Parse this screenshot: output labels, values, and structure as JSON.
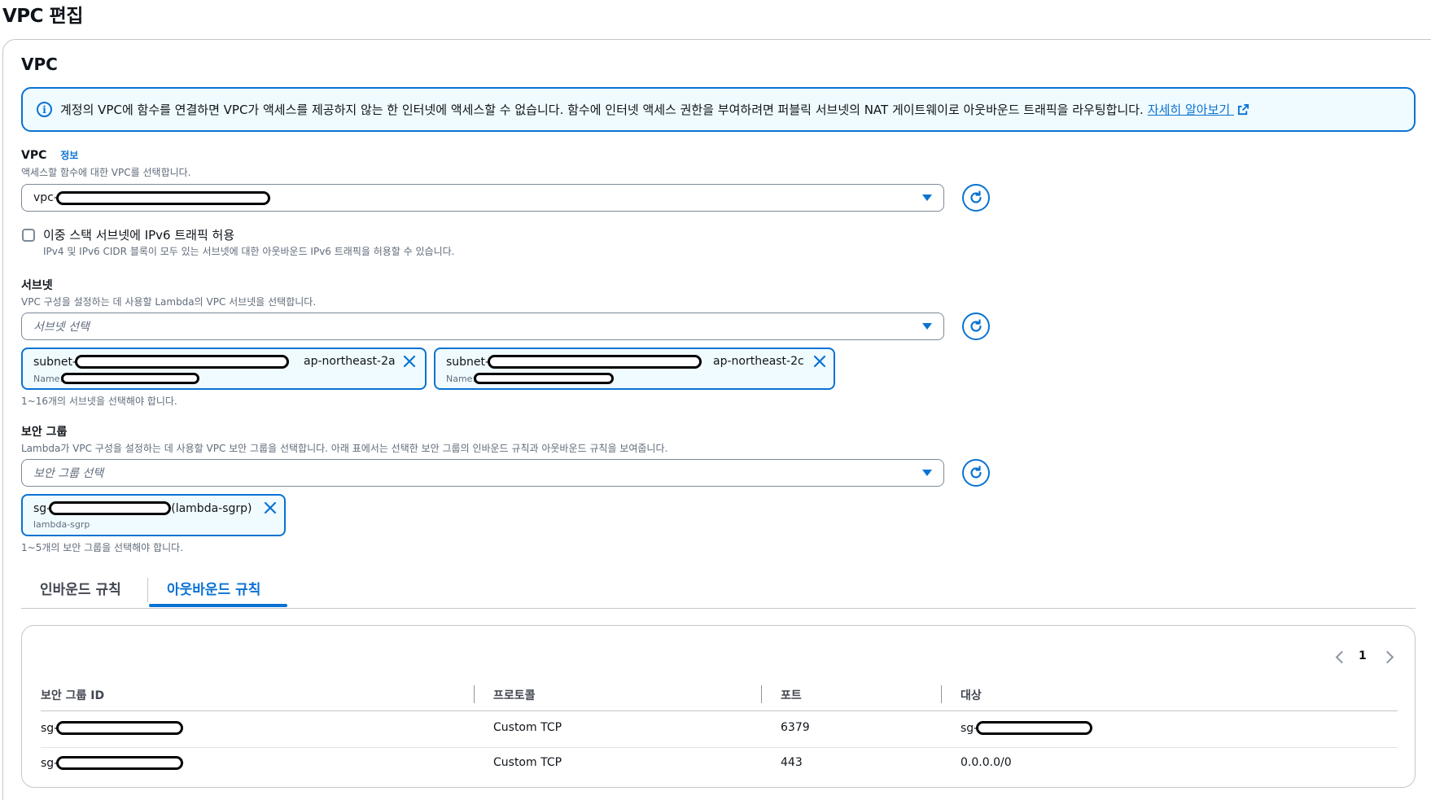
{
  "page": {
    "title": "VPC 편집"
  },
  "section": {
    "title": "VPC"
  },
  "alert": {
    "text": "계정의 VPC에 함수를 연결하면 VPC가 액세스를 제공하지 않는 한 인터넷에 액세스할 수 없습니다. 함수에 인터넷 액세스 권한을 부여하려면 퍼블릭 서브넷의 NAT 게이트웨이로 아웃바운드 트래픽을 라우팅합니다.",
    "link": "자세히 알아보기",
    "icon": "info-icon",
    "accent": "#0972d3"
  },
  "vpc": {
    "label": "VPC",
    "info": "정보",
    "description": "액세스할 함수에 대한 VPC를 선택합니다.",
    "value_prefix": "vpc-"
  },
  "dualstack": {
    "label": "이중 스택 서브넷에 IPv6 트래픽 허용",
    "description": "IPv4 및 IPv6 CIDR 블록이 모두 있는 서브넷에 대한 아웃바운드 IPv6 트래픽을 허용할 수 있습니다."
  },
  "subnets": {
    "label": "서브넷",
    "description": "VPC 구성을 설정하는 데 사용할 Lambda의 VPC 서브넷을 선택합니다.",
    "placeholder": "서브넷 선택",
    "tokens": [
      {
        "prefix": "subnet-",
        "az": "ap-northeast-2a",
        "name_label": "Name:"
      },
      {
        "prefix": "subnet-",
        "az": "ap-northeast-2c",
        "name_label": "Name:"
      }
    ],
    "hint": "1~16개의 서브넷을 선택해야 합니다."
  },
  "security_groups": {
    "label": "보안 그룹",
    "description": "Lambda가 VPC 구성을 설정하는 데 사용할 VPC 보안 그룹을 선택합니다. 아래 표에서는 선택한 보안 그룹의 인바운드 규칙과 아웃바운드 규칙을 보여줍니다.",
    "placeholder": "보안 그룹 선택",
    "token": {
      "prefix": "sg-",
      "suffix": "(lambda-sgrp)",
      "sub": "lambda-sgrp"
    },
    "hint": "1~5개의 보안 그룹을 선택해야 합니다."
  },
  "tabs": [
    {
      "label": "인바운드 규칙",
      "active": false
    },
    {
      "label": "아웃바운드 규칙",
      "active": true
    }
  ],
  "table": {
    "page": "1",
    "columns": [
      "보안 그룹 ID",
      "프로토콜",
      "포트",
      "대상"
    ],
    "rows": [
      {
        "sg_prefix": "sg-",
        "protocol": "Custom TCP",
        "port": "6379",
        "dest_prefix": "sg-",
        "dest": ""
      },
      {
        "sg_prefix": "sg-",
        "protocol": "Custom TCP",
        "port": "443",
        "dest_prefix": "",
        "dest": "0.0.0.0/0"
      }
    ]
  }
}
